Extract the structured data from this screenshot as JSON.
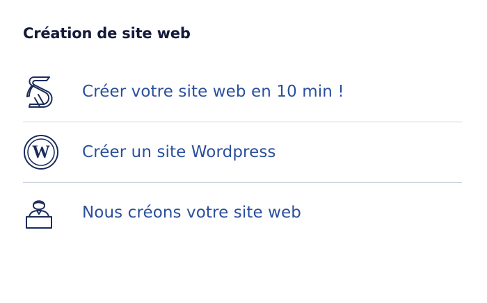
{
  "section": {
    "title": "Création de site web"
  },
  "menu": {
    "items": [
      {
        "label": "Créer votre site web en 10 min !",
        "icon": "site-builder-s-logo-icon"
      },
      {
        "label": "Créer un site Wordpress",
        "icon": "wordpress-icon"
      },
      {
        "label": "Nous créons votre site web",
        "icon": "person-at-desk-icon"
      }
    ]
  },
  "colors": {
    "title": "#141a3a",
    "link": "#2a4f9c",
    "icon": "#1b2b5a",
    "divider": "#c9d0dc"
  }
}
